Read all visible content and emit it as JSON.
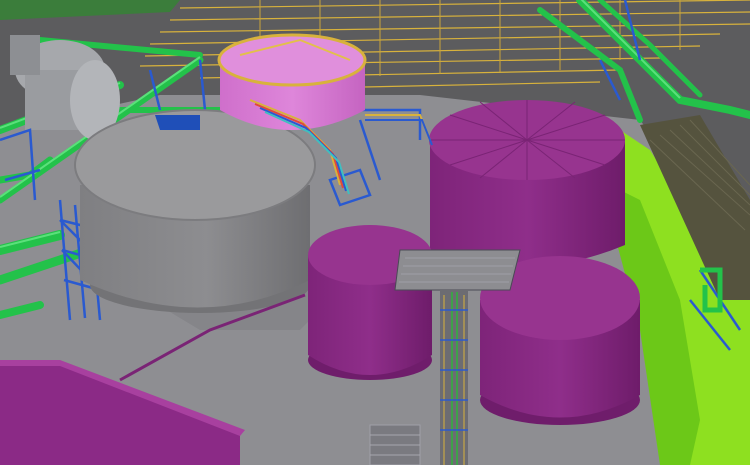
{
  "scene": {
    "kind": "3D plant model viewport",
    "palette": {
      "ground": "#8e8e92",
      "road": "#5c5c5e",
      "gray_tank": "#8a8a8c",
      "gray_tank_roof": "#9a9a9c",
      "purple_tank": "#8b2a86",
      "purple_tank_top": "#97348f",
      "pink_tank": "#d77ad3",
      "green_pipe": "#23c24a",
      "blue_steel": "#2a5ad0",
      "lime_area": "#8ee020",
      "yellow_cables": "#d8b23c",
      "olive_rack": "#55533e"
    },
    "tanks": [
      {
        "name": "gray-storage-tank",
        "color": "gray"
      },
      {
        "name": "pink-domed-tank",
        "color": "pink"
      },
      {
        "name": "large-purple-tank",
        "color": "purple"
      },
      {
        "name": "small-purple-tank-left",
        "color": "purple"
      },
      {
        "name": "small-purple-tank-right",
        "color": "purple"
      }
    ]
  }
}
